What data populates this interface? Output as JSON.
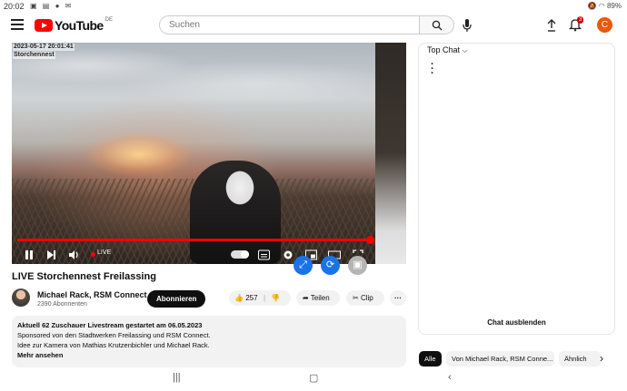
{
  "status_bar": {
    "time": "20:02",
    "battery": "89%"
  },
  "header": {
    "logo_text": "YouTube",
    "logo_region": "DE",
    "search_placeholder": "Suchen",
    "notification_count": "3",
    "avatar_letter": "C"
  },
  "video": {
    "timestamp_overlay": "2023-05-17 20:01:41",
    "camera_label": "Storchennest",
    "live_label": "LIVE",
    "progress_percent": 100
  },
  "meta": {
    "title": "LIVE Storchennest Freilassing",
    "channel_name": "Michael Rack, RSM Connect",
    "subscribers": "2390 Abonnenten",
    "subscribe_label": "Abonnieren",
    "like_count": "257",
    "share_label": "Teilen",
    "clip_label": "Clip"
  },
  "description": {
    "line1": "Aktuell 62 Zuschauer  Livestream gestartet am 06.05.2023",
    "line2": "Sponsored von den Stadtwerken Freilassing und RSM Connect.",
    "line3": "Idee zur Kamera von Mathias Krutzenbichler und Michael Rack.",
    "more_label": "Mehr ansehen"
  },
  "chat": {
    "title": "Top Chat",
    "hide_label": "Chat ausblenden"
  },
  "chips": [
    {
      "label": "Alle",
      "active": true
    },
    {
      "label": "Von Michael Rack, RSM Conne...",
      "active": false
    },
    {
      "label": "Ähnlich",
      "active": false
    }
  ],
  "colors": {
    "accent_red": "#ff0000",
    "fab_blue": "#1a73e8",
    "avatar_orange": "#e8590c"
  }
}
